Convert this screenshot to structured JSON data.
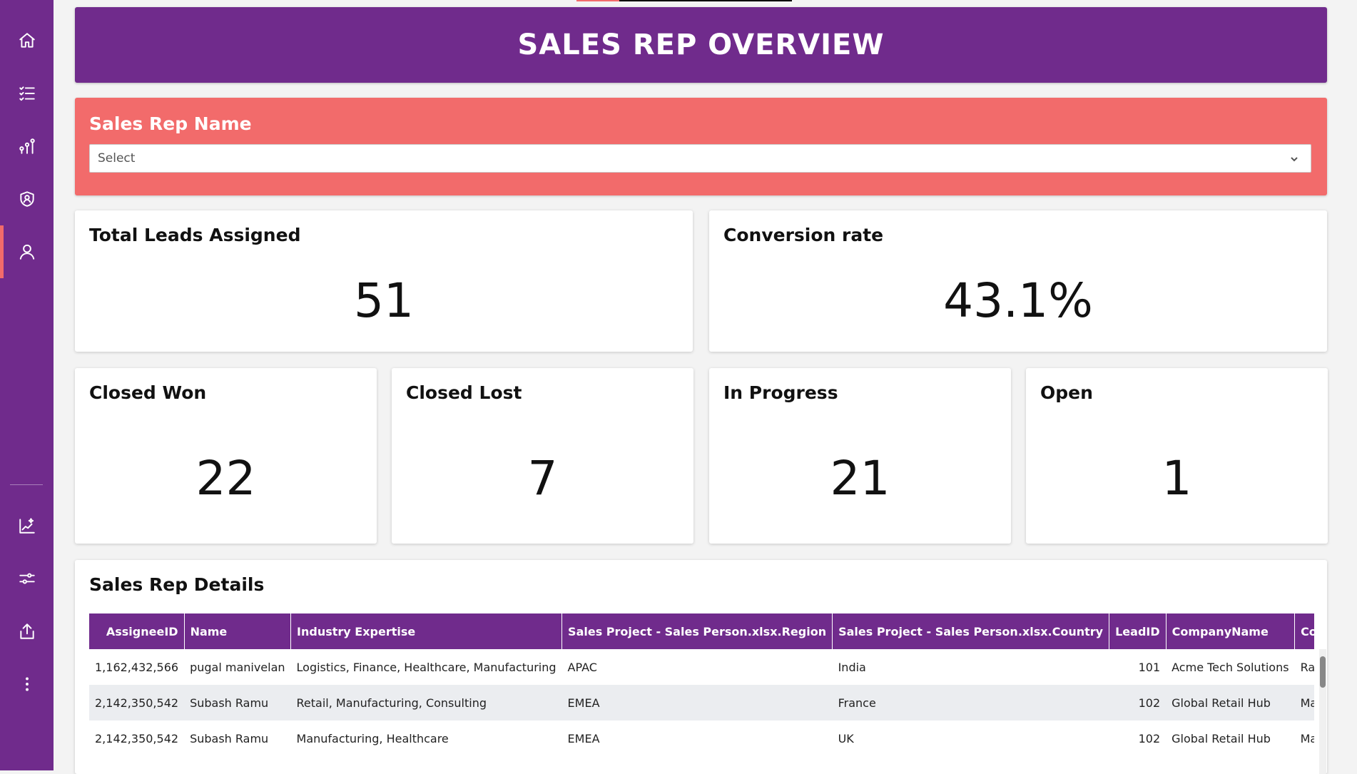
{
  "sidebar": {
    "top_items": [
      {
        "name": "home",
        "icon": "home-icon"
      },
      {
        "name": "tasks",
        "icon": "checklist-icon"
      },
      {
        "name": "analytics",
        "icon": "analytics-icon"
      },
      {
        "name": "security",
        "icon": "shield-user-icon"
      },
      {
        "name": "people",
        "icon": "person-icon",
        "active": true
      }
    ],
    "bottom_items": [
      {
        "name": "insights",
        "icon": "chart-sparkle-icon"
      },
      {
        "name": "settings",
        "icon": "sliders-icon"
      },
      {
        "name": "share",
        "icon": "share-upload-icon"
      },
      {
        "name": "more",
        "icon": "more-vertical-icon"
      }
    ]
  },
  "header": {
    "title": "SALES REP OVERVIEW"
  },
  "filter": {
    "label": "Sales Rep Name",
    "placeholder": "Select"
  },
  "kpis": {
    "total_leads": {
      "title": "Total Leads Assigned",
      "value": "51"
    },
    "conversion": {
      "title": "Conversion rate",
      "value": "43.1%"
    },
    "closed_won": {
      "title": "Closed Won",
      "value": "22"
    },
    "closed_lost": {
      "title": "Closed Lost",
      "value": "7"
    },
    "in_progress": {
      "title": "In Progress",
      "value": "21"
    },
    "open": {
      "title": "Open",
      "value": "1"
    }
  },
  "details": {
    "title": "Sales Rep Details",
    "columns": [
      "AssigneeID",
      "Name",
      "Industry Expertise",
      "Sales Project - Sales Person.xlsx.Region",
      "Sales Project - Sales Person.xlsx.Country",
      "LeadID",
      "CompanyName",
      "ContactPerson"
    ],
    "rows": [
      [
        "1,162,432,566",
        "pugal manivelan",
        "Logistics, Finance, Healthcare, Manufacturing",
        "APAC",
        "India",
        "101",
        "Acme Tech Solutions",
        "Rahul Mehta"
      ],
      [
        "2,142,350,542",
        "Subash Ramu",
        "Retail, Manufacturing, Consulting",
        "EMEA",
        "France",
        "102",
        "Global Retail Hub",
        "Marie Laurent"
      ],
      [
        "2,142,350,542",
        "Subash Ramu",
        "Manufacturing, Healthcare",
        "EMEA",
        "UK",
        "102",
        "Global Retail Hub",
        "Marie Laurent"
      ]
    ]
  },
  "colors": {
    "primary": "#702b8c",
    "accent": "#f26b6b"
  }
}
